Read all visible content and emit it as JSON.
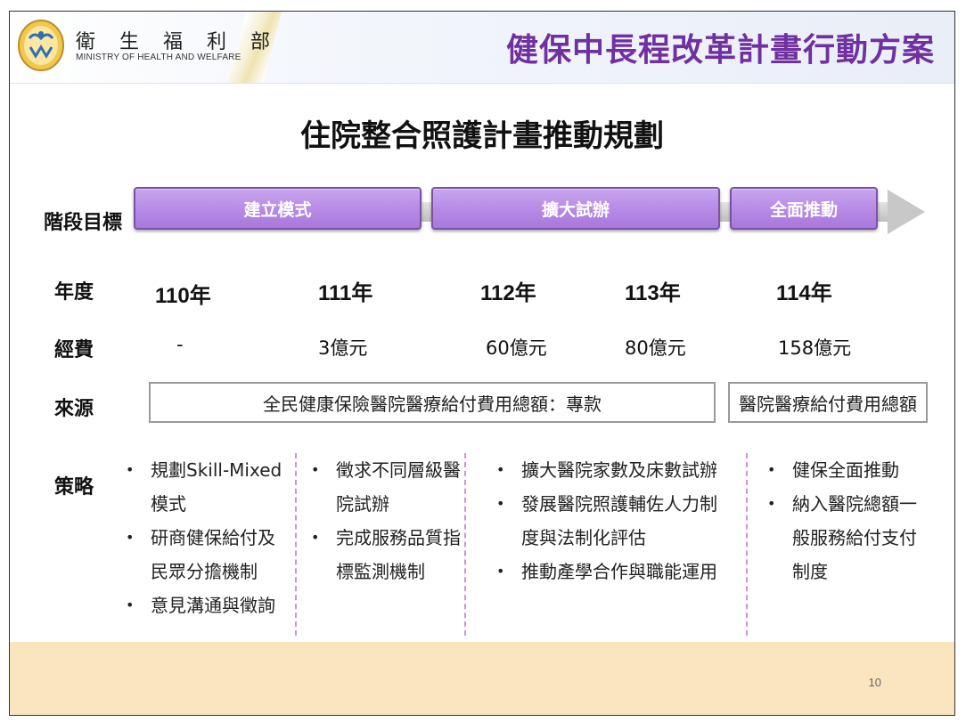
{
  "header": {
    "org_name_cn": "衛 生 福 利 部",
    "org_name_en": "MINISTRY OF HEALTH AND WELFARE",
    "deck_title": "健保中長程改革計畫行動方案"
  },
  "title": "住院整合照護計畫推動規劃",
  "row_labels": {
    "stage": "階段目標",
    "year": "年度",
    "budget": "經費",
    "source": "來源",
    "strategy": "策略"
  },
  "stages": [
    "建立模式",
    "擴大試辦",
    "全面推動"
  ],
  "years": [
    "110年",
    "111年",
    "112年",
    "113年",
    "114年"
  ],
  "budgets": [
    "-",
    "3億元",
    "60億元",
    "80億元",
    "158億元"
  ],
  "sources": [
    "全民健康保險醫院醫療給付費用總額：專款",
    "醫院醫療給付費用總額"
  ],
  "strategies": [
    [
      "規劃Skill-Mixed模式",
      "研商健保給付及民眾分擔機制",
      "意見溝通與徵詢"
    ],
    [
      "徵求不同層級醫院試辦",
      "完成服務品質指標監測機制"
    ],
    [
      "擴大醫院家數及床數試辦",
      "發展醫院照護輔佐人力制度與法制化評估",
      "推動產學合作與職能運用"
    ],
    [
      "健保全面推動",
      "納入醫院總額一般服務給付支付制度"
    ]
  ],
  "page_number": "10",
  "colors": {
    "accent_purple": "#7030a0",
    "stage_fill": "#b689e6",
    "footer": "#fae5bf",
    "divider": "#d98fd6"
  }
}
